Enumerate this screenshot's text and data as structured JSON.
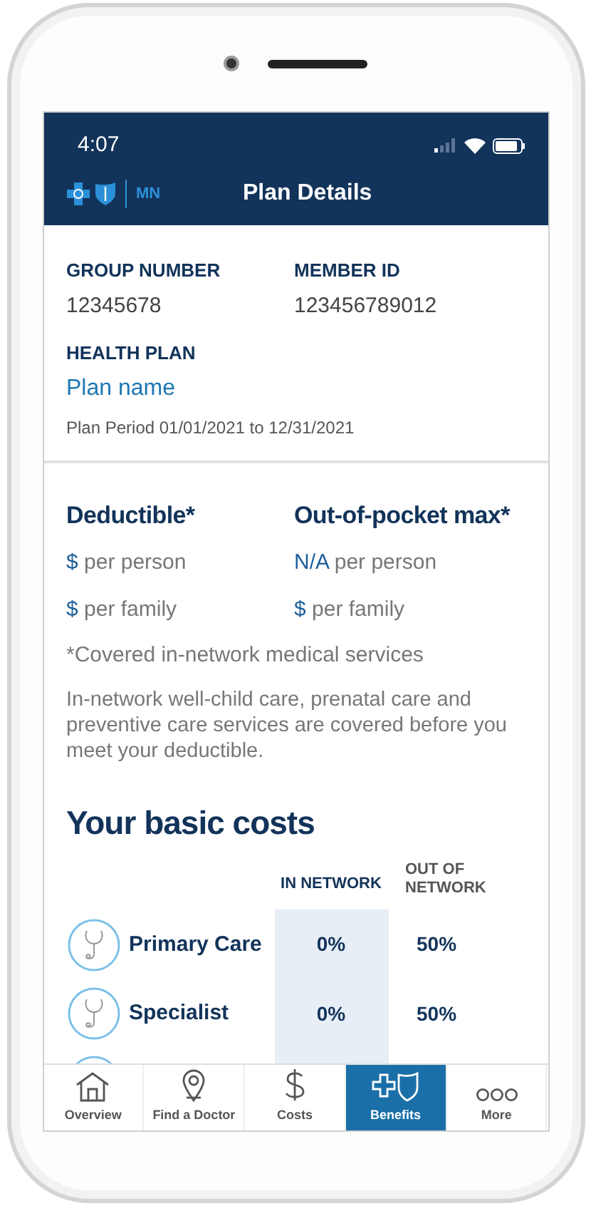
{
  "status_bar": {
    "time": "4:07"
  },
  "header": {
    "region": "MN",
    "title": "Plan Details"
  },
  "member": {
    "fields": [
      {
        "label": "GROUP NUMBER",
        "value": "12345678"
      },
      {
        "label": "MEMBER ID",
        "value": "123456789012"
      }
    ],
    "plan_label": "HEALTH PLAN",
    "plan_name": "Plan name",
    "plan_period": "Plan Period 01/01/2021 to 12/31/2021"
  },
  "limits": [
    {
      "title": "Deductible*",
      "lines": [
        {
          "amount": "$",
          "text": "per person"
        },
        {
          "amount": "$",
          "text": "per family"
        }
      ]
    },
    {
      "title": "Out-of-pocket max*",
      "lines": [
        {
          "amount": "N/A",
          "text": "per person"
        },
        {
          "amount": "$",
          "text": "per family"
        }
      ]
    }
  ],
  "footnote": "*Covered in-network medical services",
  "note": "In-network well-child care, prenatal care and preventive care services are covered before you meet your deductible.",
  "costs": {
    "title": "Your basic costs",
    "columns": [
      "IN NETWORK",
      "OUT OF NETWORK"
    ],
    "rows": [
      {
        "label": "Primary Care",
        "in_network": "0%",
        "out_of_network": "50%"
      },
      {
        "label": "Specialist",
        "in_network": "0%",
        "out_of_network": "50%"
      }
    ]
  },
  "tabs": [
    {
      "kind": "home",
      "label": "Overview",
      "selected": false
    },
    {
      "kind": "pin",
      "label": "Find a Doctor",
      "selected": false
    },
    {
      "kind": "dollar",
      "label": "Costs",
      "selected": false
    },
    {
      "kind": "benefits",
      "label": "Benefits",
      "selected": true
    },
    {
      "kind": "more",
      "label": "More",
      "selected": false
    }
  ]
}
